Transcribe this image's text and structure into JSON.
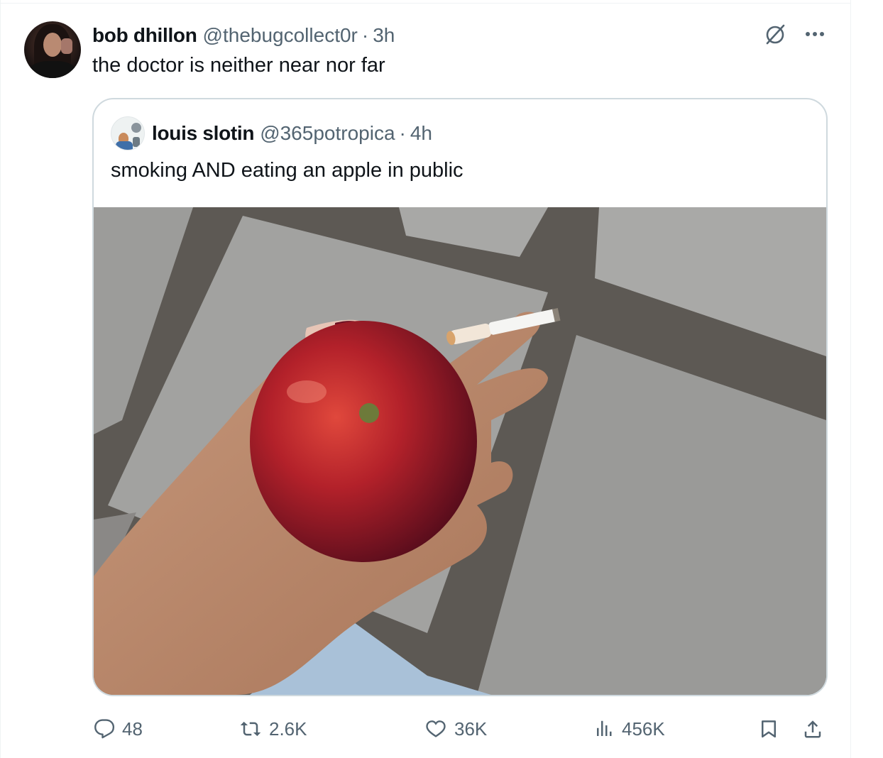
{
  "tweet": {
    "author": {
      "name": "bob dhillon",
      "handle": "@thebugcollect0r",
      "separator": "·",
      "time": "3h"
    },
    "text": "the doctor is neither near nor far",
    "icons": {
      "grok": "grok-slash-circle-icon",
      "more": "more-horizontal-icon"
    }
  },
  "quote": {
    "author": {
      "name": "louis slotin",
      "handle": "@365potropica",
      "separator": "·",
      "time": "4h"
    },
    "text": "smoking AND eating an apple in public",
    "media": "photo-hand-holding-apple-and-cigarette"
  },
  "actions": {
    "reply": {
      "icon": "reply-icon",
      "count": "48"
    },
    "retweet": {
      "icon": "retweet-icon",
      "count": "2.6K"
    },
    "like": {
      "icon": "heart-icon",
      "count": "36K"
    },
    "views": {
      "icon": "analytics-icon",
      "count": "456K"
    },
    "bookmark": {
      "icon": "bookmark-icon"
    },
    "share": {
      "icon": "share-icon"
    }
  },
  "colors": {
    "text_primary": "#0f1419",
    "text_secondary": "#536471",
    "border": "#cfd9de"
  }
}
